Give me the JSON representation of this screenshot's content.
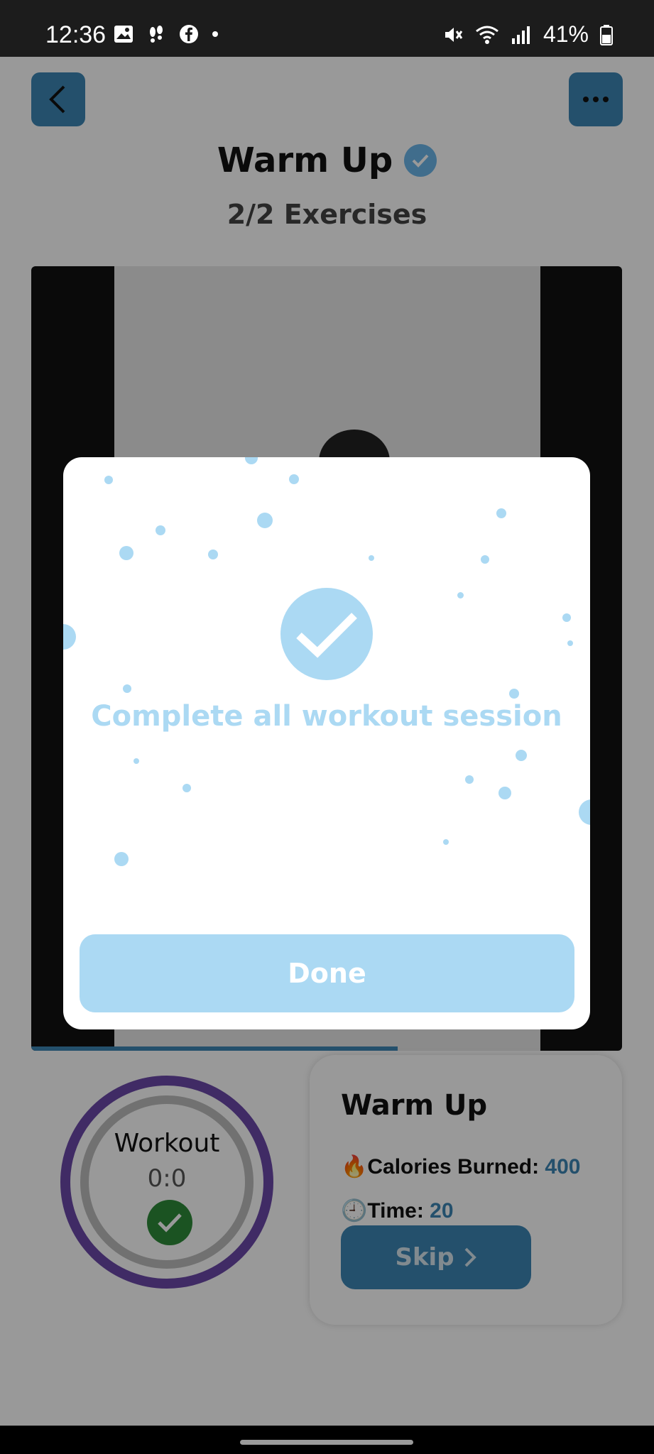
{
  "status_bar": {
    "time": "12:36",
    "battery": "41%"
  },
  "header": {
    "title": "Warm Up",
    "subtitle": "2/2 Exercises"
  },
  "progress_ring": {
    "label": "Workout",
    "value": "0:0"
  },
  "info_card": {
    "title": "Warm Up",
    "calories_label": "🔥Calories Burned:",
    "calories_value": "400",
    "time_label": "🕘Time:",
    "time_value": "20",
    "skip_label": "Skip"
  },
  "modal": {
    "message": "Complete all workout session",
    "done_label": "Done"
  },
  "colors": {
    "accent": "#3d86b5",
    "modal_accent": "#abd9f3",
    "ring": "#6b49a8",
    "success": "#2e8b3a"
  },
  "icons": [
    "image-icon",
    "footsteps-icon",
    "facebook-icon",
    "mute-icon",
    "wifi-icon",
    "signal-icon",
    "battery-icon",
    "back-arrow-icon",
    "more-icon",
    "verified-icon",
    "check-icon",
    "chevron-right-icon"
  ]
}
